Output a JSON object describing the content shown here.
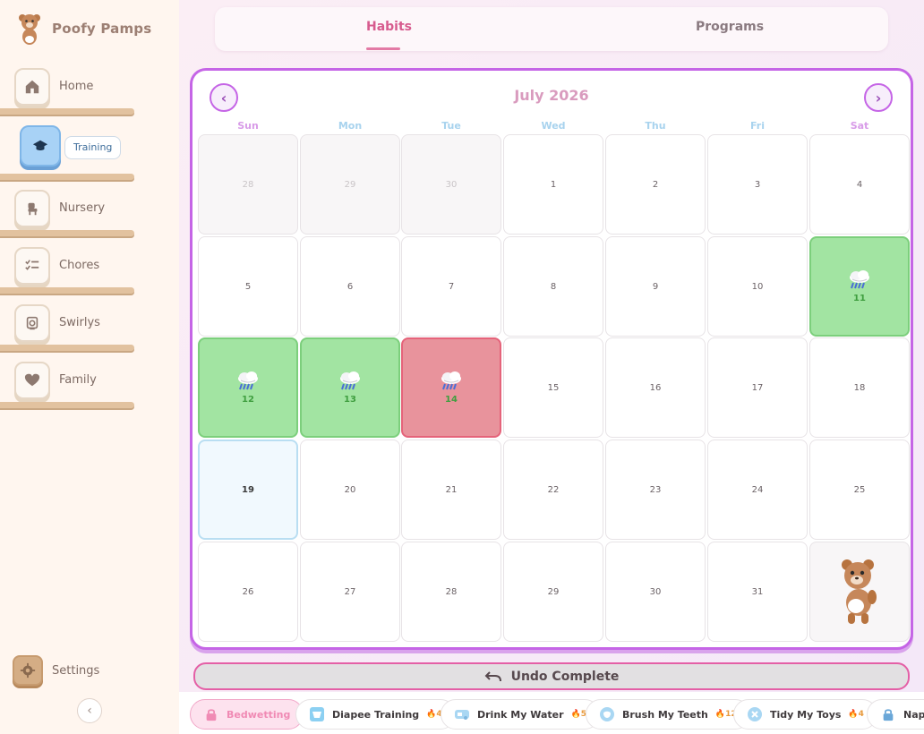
{
  "app": {
    "name": "Poofy Pamps"
  },
  "sidebar": {
    "items": [
      {
        "label": "Home",
        "icon": "home-icon"
      },
      {
        "label": "Training",
        "icon": "graduation-cap-icon",
        "active": true
      },
      {
        "label": "Nursery",
        "icon": "crib-icon"
      },
      {
        "label": "Chores",
        "icon": "checklist-icon"
      },
      {
        "label": "Swirlys",
        "icon": "toilet-icon"
      },
      {
        "label": "Family",
        "icon": "heart-icon"
      }
    ],
    "settings_label": "Settings"
  },
  "tabs": {
    "habits": "Habits",
    "programs": "Programs",
    "active": "Habits"
  },
  "calendar": {
    "title": "July 2026",
    "days_of_week": [
      "Sun",
      "Mon",
      "Tue",
      "Wed",
      "Thu",
      "Fri",
      "Sat"
    ],
    "dow_colors": [
      "#d89ce8",
      "#a8d3ee",
      "#a8d3ee",
      "#a8d3ee",
      "#a8d3ee",
      "#a8d3ee",
      "#d89ce8"
    ],
    "weeks": [
      [
        {
          "n": "28",
          "s": "other"
        },
        {
          "n": "29",
          "s": "other"
        },
        {
          "n": "30",
          "s": "other"
        },
        {
          "n": "1",
          "s": ""
        },
        {
          "n": "2",
          "s": ""
        },
        {
          "n": "3",
          "s": ""
        },
        {
          "n": "4",
          "s": ""
        }
      ],
      [
        {
          "n": "5",
          "s": ""
        },
        {
          "n": "6",
          "s": ""
        },
        {
          "n": "7",
          "s": ""
        },
        {
          "n": "8",
          "s": ""
        },
        {
          "n": "9",
          "s": ""
        },
        {
          "n": "10",
          "s": ""
        },
        {
          "n": "11",
          "s": "green"
        }
      ],
      [
        {
          "n": "12",
          "s": "green"
        },
        {
          "n": "13",
          "s": "green"
        },
        {
          "n": "14",
          "s": "red"
        },
        {
          "n": "15",
          "s": ""
        },
        {
          "n": "16",
          "s": ""
        },
        {
          "n": "17",
          "s": ""
        },
        {
          "n": "18",
          "s": ""
        }
      ],
      [
        {
          "n": "19",
          "s": "today"
        },
        {
          "n": "20",
          "s": ""
        },
        {
          "n": "21",
          "s": ""
        },
        {
          "n": "22",
          "s": ""
        },
        {
          "n": "23",
          "s": ""
        },
        {
          "n": "24",
          "s": ""
        },
        {
          "n": "25",
          "s": ""
        }
      ],
      [
        {
          "n": "26",
          "s": ""
        },
        {
          "n": "27",
          "s": ""
        },
        {
          "n": "28",
          "s": ""
        },
        {
          "n": "29",
          "s": ""
        },
        {
          "n": "30",
          "s": ""
        },
        {
          "n": "31",
          "s": ""
        },
        {
          "n": "",
          "s": "mascot"
        }
      ]
    ]
  },
  "undo_label": "Undo Complete",
  "habits": [
    {
      "label": "Bedwetting",
      "count": "",
      "icon": "lock-icon",
      "state": "locked-active"
    },
    {
      "label": "Diapee Training",
      "count": "4",
      "icon": "diaper-icon"
    },
    {
      "label": "Drink My Water",
      "count": "5",
      "icon": "sippy-cup-icon"
    },
    {
      "label": "Brush My Teeth",
      "count": "12",
      "icon": "tooth-icon"
    },
    {
      "label": "Tidy My Toys",
      "count": "4",
      "icon": "toy-icon"
    },
    {
      "label": "Nap Time",
      "count": "",
      "icon": "lock-icon"
    }
  ],
  "colors": {
    "accent": "#c565e6",
    "habit_active": "#d75b8e",
    "complete": "#a2e4a2",
    "missed": "#e8939c"
  }
}
